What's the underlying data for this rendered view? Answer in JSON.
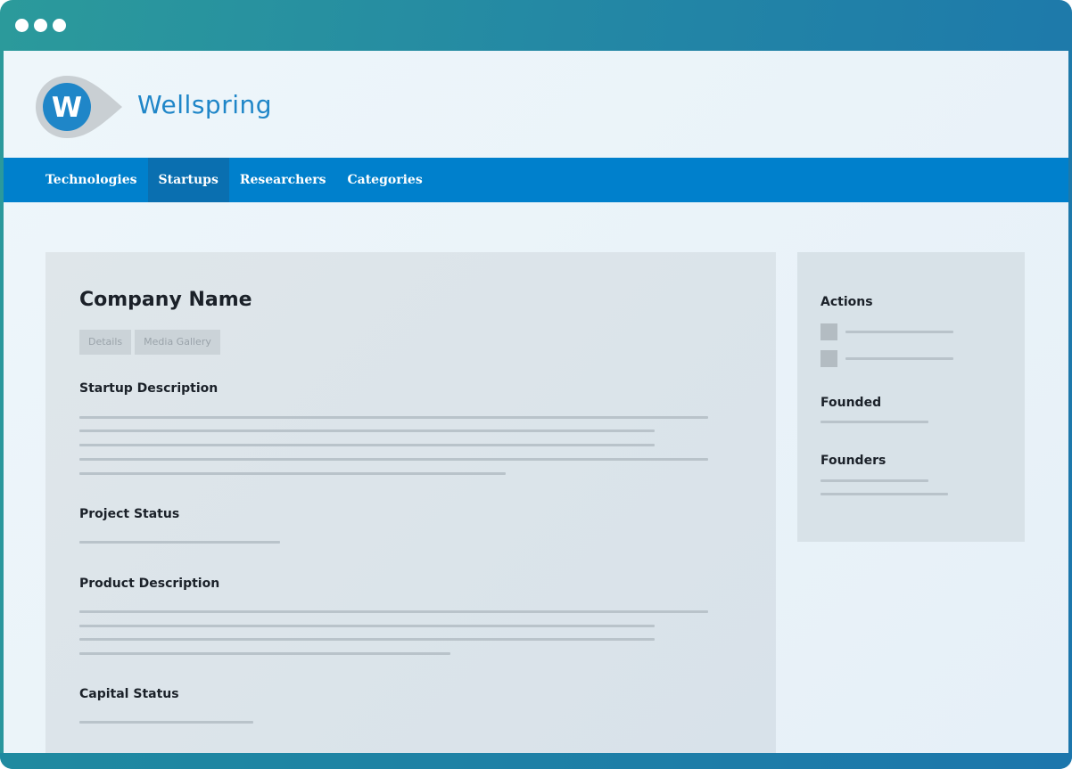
{
  "window": {
    "dots": [
      "",
      "",
      ""
    ]
  },
  "brand": {
    "name": "Wellspring",
    "logo_letter": "W",
    "accent_color": "#1f86c8"
  },
  "nav": {
    "items": [
      {
        "label": "Technologies",
        "active": false
      },
      {
        "label": "Startups",
        "active": true
      },
      {
        "label": "Researchers",
        "active": false
      },
      {
        "label": "Categories",
        "active": false
      }
    ],
    "bar_color": "#0080cc"
  },
  "main": {
    "title": "Company Name",
    "tabs": [
      {
        "label": "Details"
      },
      {
        "label": "Media Gallery"
      }
    ],
    "sections": {
      "startup_description": "Startup Description",
      "project_status": "Project Status",
      "product_description": "Product Description",
      "capital_status": "Capital Status"
    }
  },
  "sidebar": {
    "actions_title": "Actions",
    "founded_title": "Founded",
    "founders_title": "Founders"
  }
}
